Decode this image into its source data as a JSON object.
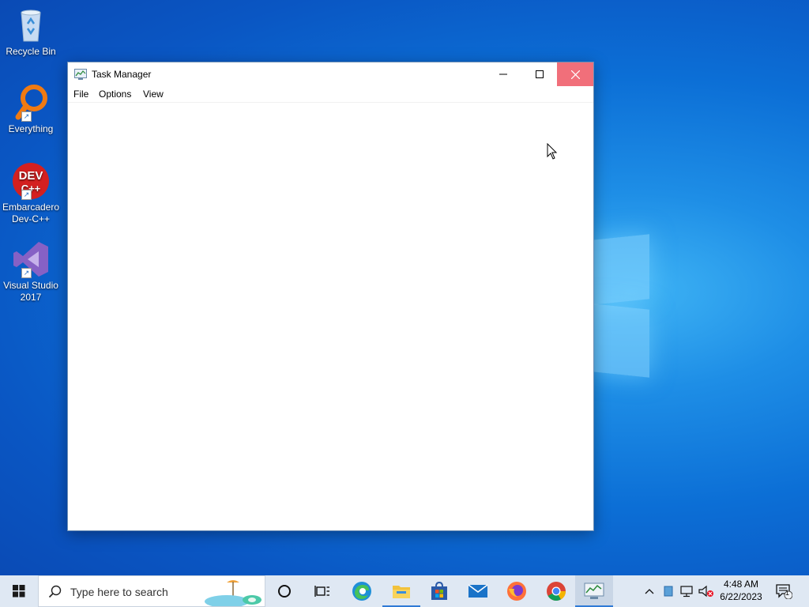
{
  "desktop": {
    "icons": [
      {
        "label": "Recycle Bin",
        "icon": "recycle-bin-icon"
      },
      {
        "label": "Everything",
        "icon": "everything-search-icon"
      },
      {
        "label": "Embarcadero Dev-C++",
        "icon": "devcpp-icon",
        "logo_text_1": "DEV",
        "logo_text_2": "C++"
      },
      {
        "label": "Visual Studio 2017",
        "icon": "visual-studio-icon"
      }
    ]
  },
  "window": {
    "title": "Task Manager",
    "menu": [
      "File",
      "Options",
      "View"
    ]
  },
  "taskbar": {
    "search_placeholder": "Type here to search",
    "pinned": [
      "cortana-icon",
      "task-view-icon",
      "edge-icon",
      "file-explorer-icon",
      "microsoft-store-icon",
      "mail-icon",
      "firefox-icon",
      "chrome-icon",
      "task-manager-icon"
    ],
    "clock_time": "4:48 AM",
    "clock_date": "6/22/2023",
    "notification_count": "1"
  },
  "colors": {
    "accent": "#2f7ad6",
    "close_button": "#e81123",
    "taskbar": "#dfe8f3"
  }
}
